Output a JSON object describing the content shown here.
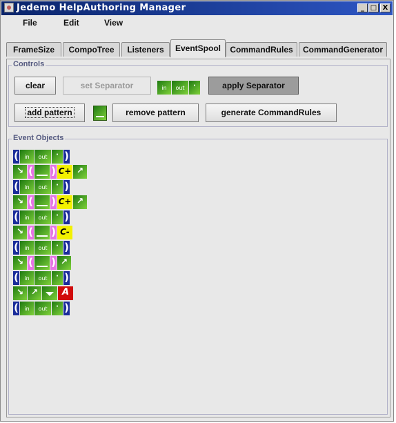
{
  "window": {
    "title": "Jedemo HelpAuthoring Manager",
    "controls": [
      "_",
      "□",
      "X"
    ]
  },
  "menu": [
    "File",
    "Edit",
    "View"
  ],
  "tabs": [
    "FrameSize",
    "CompoTree",
    "Listeners",
    "EventSpool",
    "CommandRules",
    "CommandGenerator"
  ],
  "active_tab": "EventSpool",
  "controls_group": {
    "title": "Controls",
    "clear_label": "clear",
    "set_separator_label": "set Separator",
    "separator_preview": {
      "in": "in",
      "out": "out",
      "dot": "·"
    },
    "apply_separator_label": "apply Separator",
    "add_pattern_label": "add pattern",
    "remove_pattern_label": "remove pattern",
    "generate_label": "generate CommandRules"
  },
  "event_objects": {
    "title": "Event Objects",
    "labels": {
      "in": "in",
      "out": "out",
      "dot": "·",
      "c_plus": "C+",
      "c_minus": "C-",
      "a": "A",
      "open_paren": "(",
      "close_paren": ")"
    },
    "rows": [
      [
        "paren_open",
        "in",
        "out",
        "dot",
        "paren_close"
      ],
      [
        "arrow_in",
        "pink_open",
        "underscore",
        "pink_close",
        "c_plus",
        "arrow_out"
      ],
      [
        "paren_open",
        "in",
        "out",
        "dot",
        "paren_close"
      ],
      [
        "arrow_in",
        "pink_open",
        "underscore",
        "pink_close",
        "c_plus",
        "arrow_out"
      ],
      [
        "paren_open",
        "in",
        "out",
        "dot",
        "paren_close"
      ],
      [
        "arrow_in",
        "pink_open",
        "underscore",
        "pink_close",
        "c_minus"
      ],
      [
        "paren_open",
        "in",
        "out",
        "dot",
        "paren_close"
      ],
      [
        "arrow_in",
        "pink_open",
        "underscore",
        "pink_close",
        "arrow_out"
      ],
      [
        "paren_open",
        "in",
        "out",
        "dot",
        "paren_close"
      ],
      [
        "arrow_in",
        "arrow_out",
        "tri_down",
        "a_red"
      ],
      [
        "paren_open",
        "in",
        "out",
        "dot",
        "paren_close"
      ]
    ]
  }
}
